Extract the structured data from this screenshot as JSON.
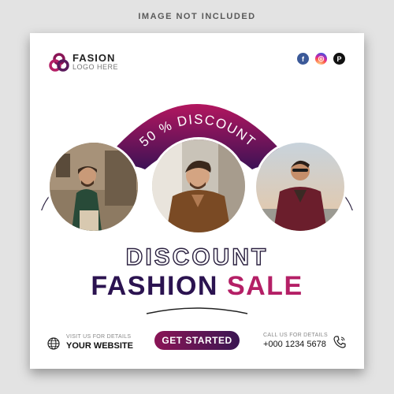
{
  "notice": "IMAGE NOT INCLUDED",
  "logo": {
    "name": "FASION",
    "sub": "LOGO HERE"
  },
  "socials": [
    {
      "icon": "facebook-icon",
      "glyph": "f"
    },
    {
      "icon": "instagram-icon",
      "glyph": "◎"
    },
    {
      "icon": "pinterest-icon",
      "glyph": "P"
    }
  ],
  "banner": {
    "text": "50 % DISCOUNT"
  },
  "headline": {
    "line1": "DISCOUNT",
    "fashion": "FASHION",
    "sale": "SALE"
  },
  "footer": {
    "visit_label": "VISIT US FOR DETAILS",
    "website": "YOUR WEBSITE",
    "cta": "GET STARTED",
    "call_label": "CALL US FOR DETAILS",
    "phone": "+000 1234 5678"
  },
  "colors": {
    "brand_dark": "#2b1350",
    "brand_pink": "#b41f66",
    "arch_top": "#b3165f",
    "arch_bottom": "#3a1255"
  }
}
